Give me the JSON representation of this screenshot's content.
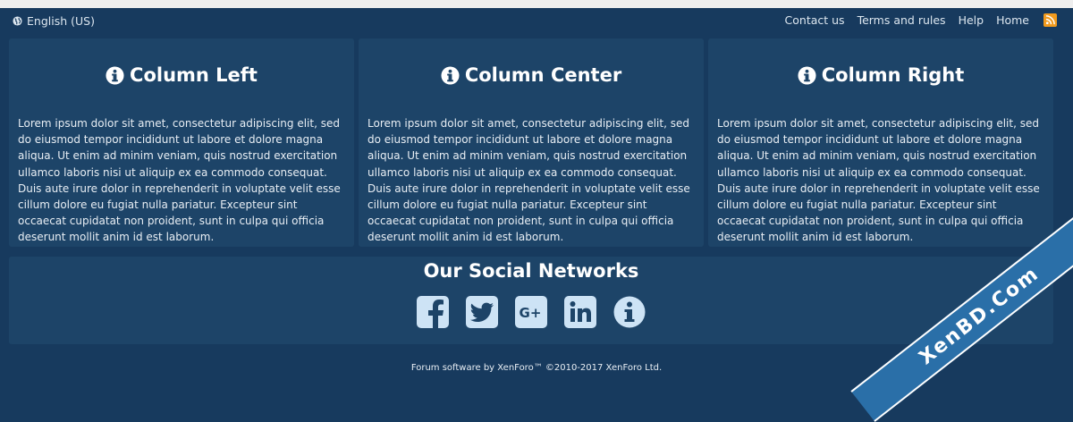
{
  "topbar": {
    "language_label": "English (US)",
    "nav": [
      "Contact us",
      "Terms and rules",
      "Help",
      "Home"
    ]
  },
  "columns": [
    {
      "title": "Column Left",
      "body": "Lorem ipsum dolor sit amet, consectetur adipiscing elit, sed do eiusmod tempor incididunt ut labore et dolore magna aliqua. Ut enim ad minim veniam, quis nostrud exercitation ullamco laboris nisi ut aliquip ex ea commodo consequat. Duis aute irure dolor in reprehenderit in voluptate velit esse cillum dolore eu fugiat nulla pariatur. Excepteur sint occaecat cupidatat non proident, sunt in culpa qui officia deserunt mollit anim id est laborum."
    },
    {
      "title": "Column Center",
      "body": "Lorem ipsum dolor sit amet, consectetur adipiscing elit, sed do eiusmod tempor incididunt ut labore et dolore magna aliqua. Ut enim ad minim veniam, quis nostrud exercitation ullamco laboris nisi ut aliquip ex ea commodo consequat. Duis aute irure dolor in reprehenderit in voluptate velit esse cillum dolore eu fugiat nulla pariatur. Excepteur sint occaecat cupidatat non proident, sunt in culpa qui officia deserunt mollit anim id est laborum."
    },
    {
      "title": "Column Right",
      "body": "Lorem ipsum dolor sit amet, consectetur adipiscing elit, sed do eiusmod tempor incididunt ut labore et dolore magna aliqua. Ut enim ad minim veniam, quis nostrud exercitation ullamco laboris nisi ut aliquip ex ea commodo consequat. Duis aute irure dolor in reprehenderit in voluptate velit esse cillum dolore eu fugiat nulla pariatur. Excepteur sint occaecat cupidatat non proident, sunt in culpa qui officia deserunt mollit anim id est laborum."
    }
  ],
  "social": {
    "title": "Our Social Networks",
    "icons": [
      "facebook-icon",
      "twitter-icon",
      "google-plus-icon",
      "linkedin-icon",
      "info-icon"
    ]
  },
  "footer": {
    "copyright": "Forum software by XenForo™ ©2010-2017 XenForo Ltd."
  },
  "watermark": "XenBD.Com",
  "colors": {
    "background": "#173a5e",
    "panel": "#1d4468",
    "icon_fill": "#cde3f5",
    "rss": "#f29b1e",
    "badge": "#2a6fa8"
  }
}
